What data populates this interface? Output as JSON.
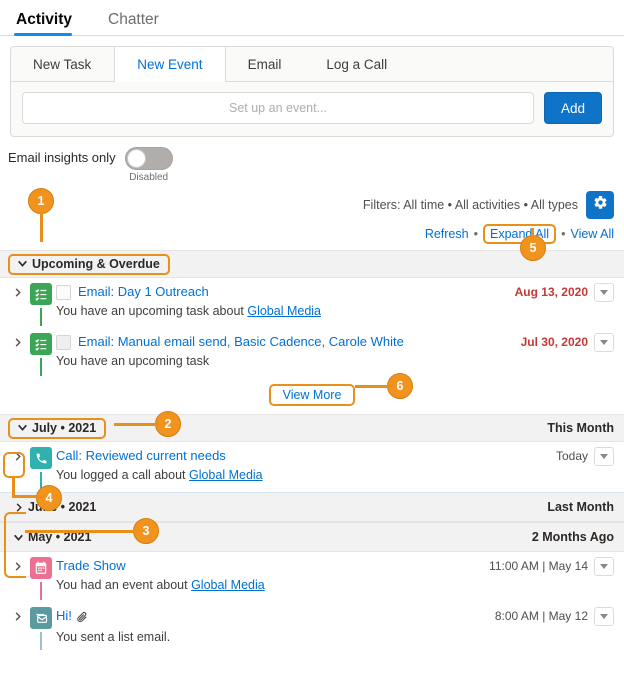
{
  "top_tabs": [
    {
      "label": "Activity",
      "active": true
    },
    {
      "label": "Chatter",
      "active": false
    }
  ],
  "composer": {
    "subtabs": [
      {
        "label": "New Task",
        "active": false
      },
      {
        "label": "New Event",
        "active": true
      },
      {
        "label": "Email",
        "active": false
      },
      {
        "label": "Log a Call",
        "active": false
      }
    ],
    "input_placeholder": "Set up an event...",
    "input_value": "",
    "add_label": "Add"
  },
  "insights": {
    "label": "Email insights only",
    "state_label": "Disabled",
    "enabled": false
  },
  "filters": {
    "text": "Filters: All time • All activities • All types",
    "gear_icon": "gear-icon",
    "refresh_label": "Refresh",
    "expand_all_label": "Expand All",
    "view_all_label": "View All",
    "separator": "•"
  },
  "timeline": {
    "sections": [
      {
        "title": "Upcoming & Overdue",
        "right_label": "",
        "expanded": true,
        "highlighted": true,
        "items": [
          {
            "icon": "task-icon",
            "icon_color": "#3ba755",
            "has_checkbox": true,
            "title": "Email: Day 1 Outreach",
            "subject_prefix": "You have an upcoming task about ",
            "subject_link": "Global Media",
            "date": "Aug 13, 2020",
            "overdue": true
          },
          {
            "icon": "task-icon",
            "icon_color": "#3ba755",
            "has_checkbox": true,
            "title": "Email: Manual email send, Basic Cadence, Carole White",
            "subject_prefix": "You have an upcoming task",
            "subject_link": "",
            "date": "Jul 30, 2020",
            "overdue": true
          }
        ],
        "view_more_label": "View More"
      },
      {
        "title": "July • 2021",
        "right_label": "This Month",
        "expanded": true,
        "highlighted": true,
        "items": [
          {
            "icon": "call-icon",
            "icon_color": "#2fb2ad",
            "has_checkbox": false,
            "title": "Call: Reviewed current needs",
            "subject_prefix": "You logged a call about ",
            "subject_link": "Global Media",
            "date": "Today",
            "overdue": false
          }
        ],
        "view_more_label": ""
      },
      {
        "title": "June • 2021",
        "right_label": "Last Month",
        "expanded": false,
        "highlighted": false,
        "items": [],
        "view_more_label": ""
      },
      {
        "title": "May • 2021",
        "right_label": "2 Months Ago",
        "expanded": true,
        "highlighted": false,
        "items": [
          {
            "icon": "event-icon",
            "icon_color": "#eb7092",
            "has_checkbox": false,
            "title": "Trade Show",
            "subject_prefix": "You had an event about ",
            "subject_link": "Global Media",
            "date": "11:00 AM | May 14",
            "overdue": false
          },
          {
            "icon": "list-email-icon",
            "icon_color": "#5a9aa0",
            "has_checkbox": false,
            "title": "Hi!",
            "attachment_icon": "paperclip-icon",
            "subject_prefix": "You sent a list email.",
            "subject_link": "",
            "date": "8:00 AM | May 12",
            "overdue": false
          }
        ],
        "view_more_label": ""
      }
    ]
  },
  "annotations": [
    {
      "number": "1",
      "target": "upcoming-overdue-header"
    },
    {
      "number": "2",
      "target": "july-2021-header"
    },
    {
      "number": "3",
      "target": "month-collapse-chevrons"
    },
    {
      "number": "4",
      "target": "activity-row-chevron"
    },
    {
      "number": "5",
      "target": "expand-all-link"
    },
    {
      "number": "6",
      "target": "view-more-button"
    }
  ],
  "colors": {
    "accent_blue": "#0070d2",
    "button_blue": "#0f74c8",
    "annotation_orange": "#e8901a",
    "bubble_orange": "#f0931f",
    "overdue_red": "#c23934",
    "task_green": "#3ba755",
    "call_teal": "#2fb2ad",
    "event_pink": "#eb7092",
    "list_email_teal": "#5a9aa0"
  }
}
